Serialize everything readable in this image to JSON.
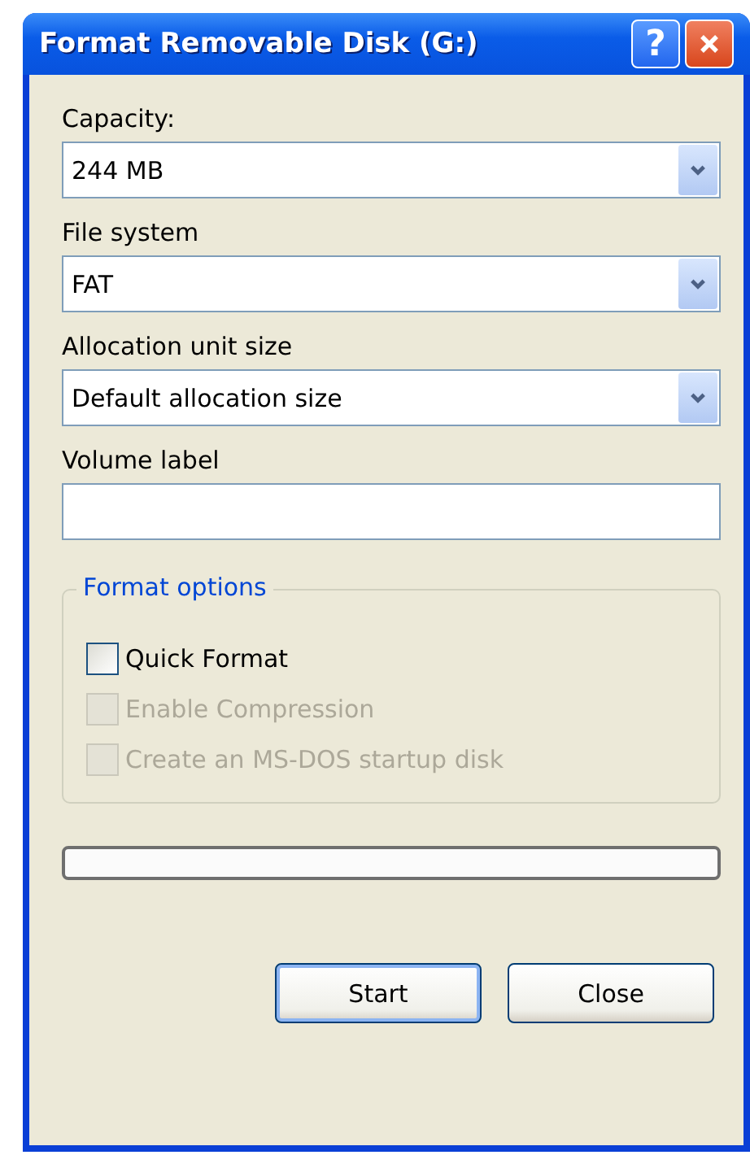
{
  "window": {
    "title": "Format Removable Disk (G:)"
  },
  "title_buttons": [
    {
      "kind": "help",
      "label": "?"
    },
    {
      "kind": "close"
    }
  ],
  "fields": [
    {
      "kind": "dropdown",
      "label": "Capacity:",
      "value": "244 MB"
    },
    {
      "kind": "dropdown",
      "label": "File system",
      "value": "FAT"
    },
    {
      "kind": "dropdown",
      "label": "Allocation unit size",
      "value": "Default allocation size"
    },
    {
      "kind": "text",
      "label": "Volume label"
    }
  ],
  "format_options": {
    "title": "Format options",
    "options": [
      {
        "label": "Quick Format",
        "checked": false,
        "disabled": false
      },
      {
        "label": "Enable Compression",
        "checked": false,
        "disabled": true
      },
      {
        "label": "Create an MS-DOS startup disk",
        "checked": false,
        "disabled": true
      }
    ]
  },
  "progress": {
    "level": 0
  },
  "buttons": [
    {
      "label": "Start",
      "default": true
    },
    {
      "label": "Close",
      "default": false
    }
  ]
}
